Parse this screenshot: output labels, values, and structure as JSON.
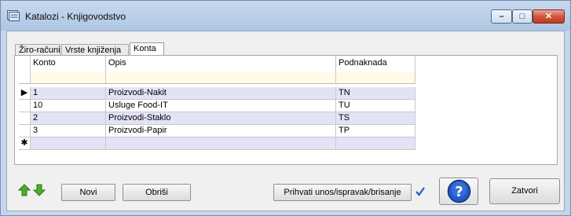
{
  "window": {
    "title": "Katalozi - Knjigovodstvo",
    "controls": {
      "minimize": "–",
      "maximize": "□",
      "close": "✕"
    }
  },
  "tabs": [
    {
      "label": "Žiro-računi",
      "active": false
    },
    {
      "label": "Vrste knjiženja",
      "active": false
    },
    {
      "label": "Konta",
      "active": true
    }
  ],
  "grid": {
    "columns": [
      "Konto",
      "Opis",
      "Podnaknada"
    ],
    "rows": [
      {
        "konto": "1",
        "opis": "Proizvodi-Nakit",
        "podnaknada": "TN",
        "current": true
      },
      {
        "konto": "10",
        "opis": "Usluge Food-IT",
        "podnaknada": "TU",
        "current": false
      },
      {
        "konto": "2",
        "opis": "Proizvodi-Staklo",
        "podnaknada": "TS",
        "current": false
      },
      {
        "konto": "3",
        "opis": "Proizvodi-Papir",
        "podnaknada": "TP",
        "current": false
      }
    ],
    "current_row_marker": "▶",
    "new_row_marker": "✱"
  },
  "buttons": {
    "novi": "Novi",
    "obrisi": "Obriši",
    "prihvati": "Prihvati unos/ispravak/brisanje",
    "zatvori": "Zatvori"
  },
  "colors": {
    "nav_arrow_green": "#4caf28",
    "check_blue": "#1f5fbf",
    "help_blue": "#1f58c9"
  }
}
